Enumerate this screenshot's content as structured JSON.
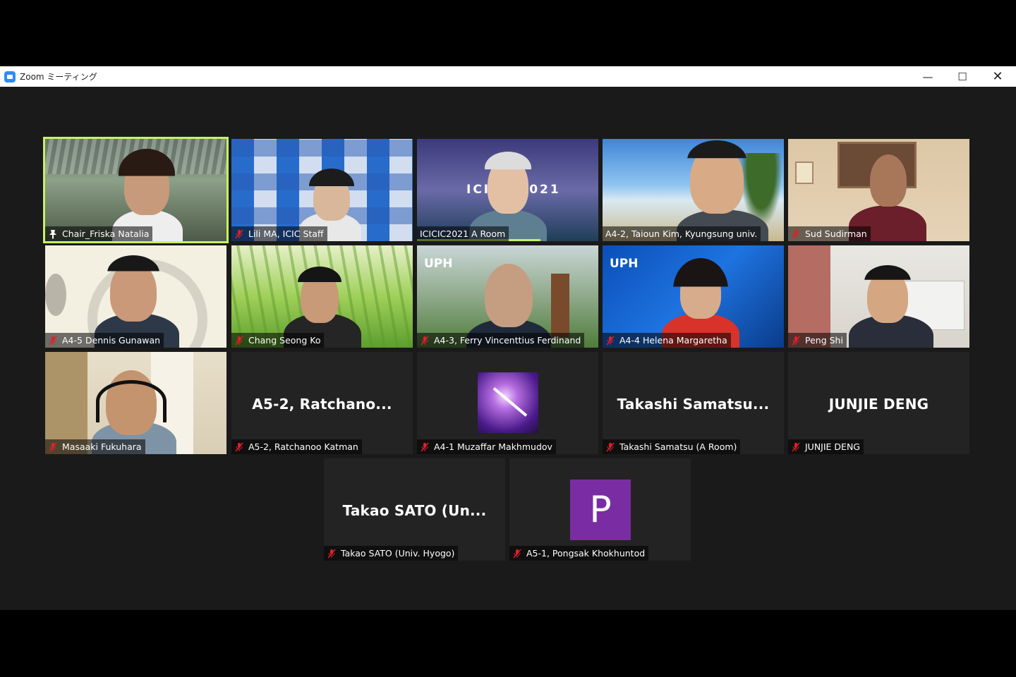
{
  "window": {
    "title": "Zoom ミーティング",
    "controls": {
      "minimize": "—",
      "maximize": "☐",
      "close": "✕"
    }
  },
  "participants": [
    {
      "name": "Chair_Friska Natalia",
      "icon": "pin-icon",
      "active_speaker": true
    },
    {
      "name": "Lili MA, ICIC Staff",
      "icon": "muted-mic-icon"
    },
    {
      "name": "ICICIC2021 A Room",
      "icon": "none"
    },
    {
      "name": "A4-2, Taioun Kim, Kyungsung univ.",
      "icon": "none"
    },
    {
      "name": "Sud Sudirman",
      "icon": "muted-mic-icon"
    },
    {
      "name": "A4-5 Dennis Gunawan",
      "icon": "muted-mic-icon"
    },
    {
      "name": "Chang Seong Ko",
      "icon": "muted-mic-icon"
    },
    {
      "name": "A4-3, Ferry Vincenttius Ferdinand",
      "icon": "muted-mic-icon"
    },
    {
      "name": "A4-4 Helena Margaretha",
      "icon": "muted-mic-icon"
    },
    {
      "name": "Peng Shi",
      "icon": "muted-mic-icon"
    },
    {
      "name": "Masaaki Fukuhara",
      "icon": "muted-mic-icon"
    },
    {
      "name": "A5-2, Ratchanoo Katman",
      "icon": "muted-mic-icon",
      "display": "A5-2,  Ratchano..."
    },
    {
      "name": "A4-1 Muzaffar Makhmudov",
      "icon": "muted-mic-icon"
    },
    {
      "name": "Takashi Samatsu (A Room)",
      "icon": "muted-mic-icon",
      "display": "Takashi  Samatsu..."
    },
    {
      "name": "JUNJIE DENG",
      "icon": "muted-mic-icon",
      "display": "JUNJIE DENG"
    },
    {
      "name": "Takao SATO (Univ. Hyogo)",
      "icon": "muted-mic-icon",
      "display": "Takao  SATO  (Un..."
    },
    {
      "name": "A5-1, Pongsak Khokhuntod",
      "icon": "muted-mic-icon",
      "avatar_letter": "P",
      "avatar_color": "#7a2da3"
    }
  ],
  "backgrounds": {
    "uph_logo": "UPH",
    "icic_logo": "ICIC 2021",
    "room_banner": "ICICIC2021"
  },
  "colors": {
    "active_border": "#c5f263",
    "muted": "#e0202a",
    "avatar": "#7a2da3"
  }
}
